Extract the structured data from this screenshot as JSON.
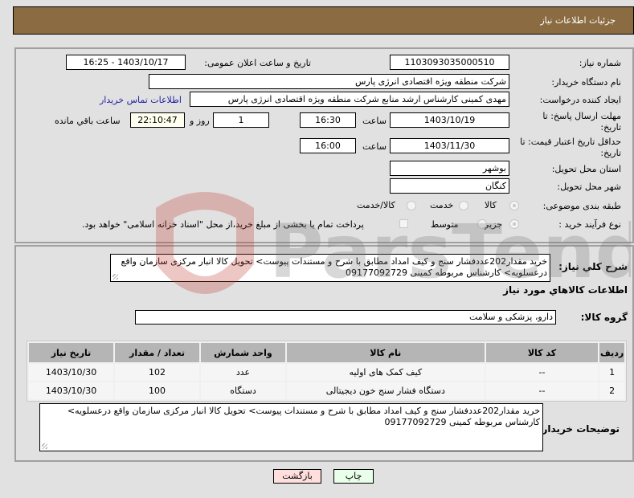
{
  "header": {
    "title": "جزئیات اطلاعات نیاز"
  },
  "form": {
    "need_number": {
      "label": "شماره نیاز:",
      "value": "1103093035000510"
    },
    "announce_datetime": {
      "label": "تاریخ و ساعت اعلان عمومی:",
      "value": "1403/10/17 - 16:25"
    },
    "buyer_org": {
      "label": "نام دستگاه خریدار:",
      "value": "شرکت منطقه ویژه اقتصادی انرژی پارس"
    },
    "creator": {
      "label": "ایجاد کننده درخواست:",
      "value": "مهدی کمینی کارشناس ارشد منابع شرکت منطقه ویژه اقتصادی انرژی پارس",
      "contact_link": "اطلاعات تماس خریدار"
    },
    "reply_deadline": {
      "label_line1": "مهلت ارسال پاسخ: تا",
      "label_line2": "تاریخ:",
      "date": "1403/10/19",
      "time_label": "ساعت",
      "time": "16:30",
      "days": "1",
      "days_label": "روز و",
      "remaining": "22:10:47",
      "remaining_label": "ساعت باقي مانده"
    },
    "price_validity": {
      "label_line1": "حداقل تاریخ اعتبار قیمت: تا",
      "label_line2": "تاریخ:",
      "date": "1403/11/30",
      "time_label": "ساعت",
      "time": "16:00"
    },
    "province": {
      "label": "استان محل تحویل:",
      "value": "بوشهر"
    },
    "city": {
      "label": "شهر محل تحویل:",
      "value": "کنگان"
    },
    "category": {
      "label": "طبقه بندی موضوعی:",
      "options": [
        {
          "label": "کالا",
          "selected": true
        },
        {
          "label": "خدمت",
          "selected": false
        },
        {
          "label": "کالا/خدمت",
          "selected": false
        }
      ]
    },
    "purchase_type": {
      "label": "نوع فرآیند خرید :",
      "options": [
        {
          "label": "جزیي",
          "selected": true
        },
        {
          "label": "متوسط",
          "selected": false
        }
      ],
      "treasury_checkbox": {
        "checked": false,
        "label": "پرداخت تمام یا بخشی از مبلغ خرید،از محل \"اسناد خزانه اسلامی\" خواهد بود."
      }
    }
  },
  "description": {
    "label": "شرح کلي نیاز:",
    "value": "خرید مقدار202عددفشار سنج و کیف امداد  مطابق با شرح  و مستندات پیوست> تحویل کالا انبار مرکزی سازمان  واقع درعسلویه> کارشناس مربوطه کمینی 09177092729"
  },
  "goods": {
    "section_title": "اطلاعات کالاهاي مورد نیاز",
    "group_label": "گروه کالا:",
    "group_value": "دارو، پزشکی و سلامت",
    "columns": [
      "ردیف",
      "کد کالا",
      "نام کالا",
      "واحد شمارش",
      "تعداد / مقدار",
      "تاریخ نیاز"
    ],
    "rows": [
      {
        "row": "1",
        "code": "--",
        "name": "کیف کمک های اولیه",
        "unit": "عدد",
        "qty": "102",
        "date": "1403/10/30"
      },
      {
        "row": "2",
        "code": "--",
        "name": "دستگاه فشار سنج خون دیجیتالی",
        "unit": "دستگاه",
        "qty": "100",
        "date": "1403/10/30"
      }
    ]
  },
  "buyer_notes": {
    "label": "توضیحات خریدار:",
    "value": "خرید مقدار202عددفشار سنج و کیف امداد  مطابق با شرح  و مستندات پیوست> تحویل کالا انبار مرکزی سازمان  واقع درعسلویه> کارشناس مربوطه کمینی 09177092729"
  },
  "buttons": {
    "print": "چاپ",
    "back": "بازگشت"
  },
  "watermark": {
    "text": "ParsTender.net"
  },
  "colors": {
    "header_bg": "#8b6c42",
    "print_btn_bg": "#eaffea",
    "back_btn_bg": "#ffdede",
    "table_header_bg": "#b5b5b5"
  }
}
